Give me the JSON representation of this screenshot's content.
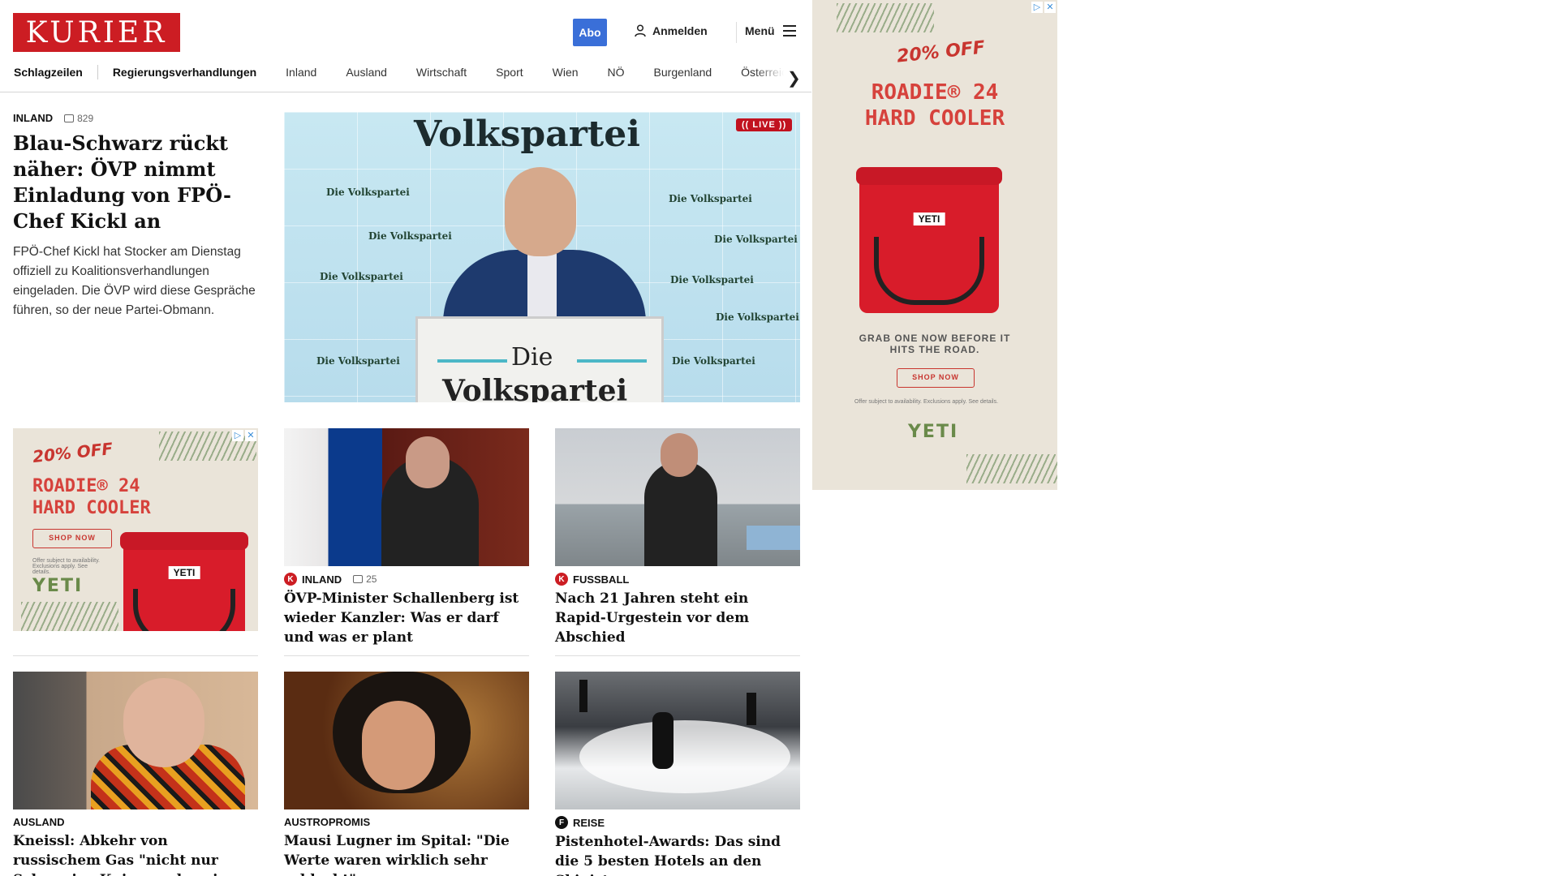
{
  "header": {
    "logo": "KURIER",
    "abo": "Abo",
    "login": "Anmelden",
    "menu": "Menü"
  },
  "nav": {
    "items": [
      "Schlagzeilen",
      "Regierungsverhandlungen",
      "Inland",
      "Ausland",
      "Wirtschaft",
      "Sport",
      "Wien",
      "NÖ",
      "Burgenland",
      "Österreich"
    ]
  },
  "lead": {
    "kicker": "INLAND",
    "comments": "829",
    "headline": "Blau-Schwarz rückt nä­her: ÖVP nimmt Einla­dung von FPÖ-Chef Kickl an",
    "teaser": "FPÖ-Chef Kickl hat Stocker am Dienstag offiziell zu Koalitionsverhandlungen eingeladen. Die ÖVP wird diese Gespräche führen, so der neue Partei-Obmann.",
    "image": {
      "brand": "Volkspartei",
      "small_label": "Die Volkspartei",
      "podium_die": "Die",
      "podium_brand": "Volkspartei",
      "live": "LIVE"
    }
  },
  "ad_side": {
    "off": "20% OFF",
    "product_line1": "ROADIE® 24",
    "product_line2": "HARD COOLER",
    "cooler_brand": "YETI",
    "grab": "GRAB ONE NOW BEFORE IT HITS THE ROAD.",
    "shop": "SHOP NOW",
    "fine": "Offer subject to availability. Exclusions apply. See details.",
    "brand": "YETI"
  },
  "ad_inline": {
    "off": "20% OFF",
    "product_line1": "ROADIE® 24",
    "product_line2": "HARD COOLER",
    "shop": "SHOP NOW",
    "fine": "Offer subject to availability. Exclusions apply. See details.",
    "brand": "YETI",
    "cooler_brand": "YETI"
  },
  "cards": [
    {
      "kicker": "INLAND",
      "comments": "25",
      "headline": "ÖVP-Minister Schallenberg ist wieder Kanzler: Was er darf und was er plant"
    },
    {
      "kicker": "FUSSBALL",
      "headline": "Nach 21 Jahren steht ein Rapid-Ur­gestein vor dem Abschied"
    },
    {
      "kicker": "AUSLAND",
      "headline": "Kneissl: Abkehr von russischem Gas \"nicht nur Schuss ins Knie, sondern ins Herz\""
    },
    {
      "kicker": "AUSTROPROMIS",
      "headline": "Mausi Lugner im Spital: \"Die Werte waren wirklich sehr schlecht\""
    },
    {
      "kicker": "REISE",
      "headline": "Pistenhotel-Awards: Das sind die 5 besten Hotels an den Skipisten"
    }
  ],
  "colors": {
    "brand_red": "#cc1d23",
    "abo_blue": "#3a6fd8",
    "live_red": "#c1121f"
  }
}
